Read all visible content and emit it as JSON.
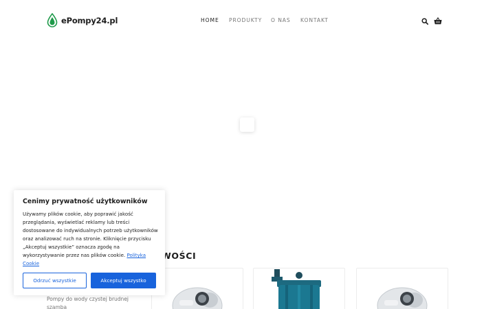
{
  "header": {
    "logo_text": "ePompy24.pl",
    "nav": [
      {
        "label": "HOME",
        "active": true
      },
      {
        "label": "PRODUKTY",
        "active": false
      },
      {
        "label": "O NAS",
        "active": false
      },
      {
        "label": "KONTAKT",
        "active": false
      }
    ],
    "icons": [
      "search-icon",
      "cart-icon"
    ]
  },
  "section": {
    "title_visible": "WOŚCI"
  },
  "products": [
    {
      "text": "Pompy do wody czystej brudnej szamba"
    }
  ],
  "cookie_banner": {
    "title": "Cenimy prywatność użytkowników",
    "body": "Używamy plików cookie, aby poprawić jakość przeglądania, wyświetlać reklamy lub treści dostosowane do indywidualnych potrzeb użytkowników oraz analizować ruch na stronie. Kliknięcie przycisku „Akceptuj wszystkie” oznacza zgodę na wykorzystywanie przez nas plików cookie.",
    "link_text": "Polityka Cookie",
    "reject_label": "Odrzuć wszystkie",
    "accept_label": "Akceptuj wszystko"
  },
  "colors": {
    "accent": "#1863dc",
    "logo_green": "#1f9a4a"
  }
}
